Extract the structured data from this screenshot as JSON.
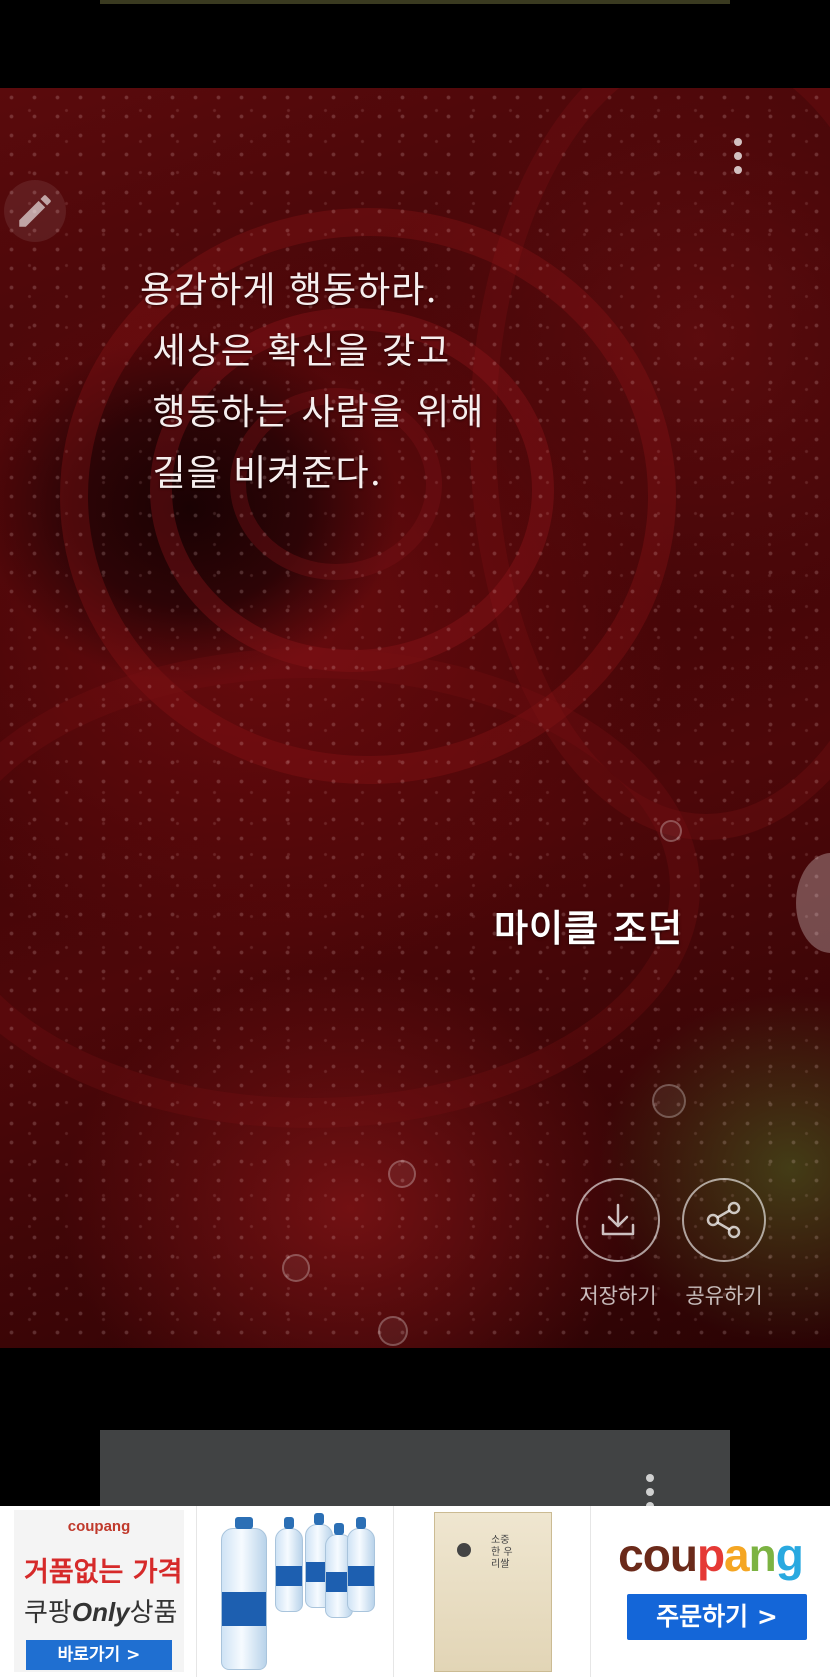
{
  "quote": {
    "lines": [
      "용감하게 행동하라.",
      " 세상은 확신을 갖고",
      " 행동하는 사람을 위해",
      " 길을 비켜준다."
    ],
    "author": "마이클 조던"
  },
  "actions": {
    "save_label": "저장하기",
    "share_label": "공유하기"
  },
  "ad": {
    "tile1": {
      "logo": "coupang",
      "headline": "거품없는 가격",
      "sub_prefix": "쿠팡",
      "sub_only": "Only",
      "sub_suffix": "상품",
      "cta": "바로가기 >"
    },
    "tile3": {
      "bag_title": "소중한 우리쌀"
    },
    "tile4": {
      "logo_letters": [
        "c",
        "o",
        "u",
        "p",
        "a",
        "n",
        "g"
      ],
      "cta": "주문하기 >"
    }
  },
  "colors": {
    "coupang_letters": [
      "#6b2a1a",
      "#6b2a1a",
      "#6b2a1a",
      "#e53935",
      "#f5a623",
      "#7cb342",
      "#29a9e0"
    ],
    "button_blue": "#1466d8"
  },
  "icons": {
    "edit": "pencil-icon",
    "menu": "more-vertical-icon",
    "save": "download-icon",
    "share": "share-icon"
  }
}
